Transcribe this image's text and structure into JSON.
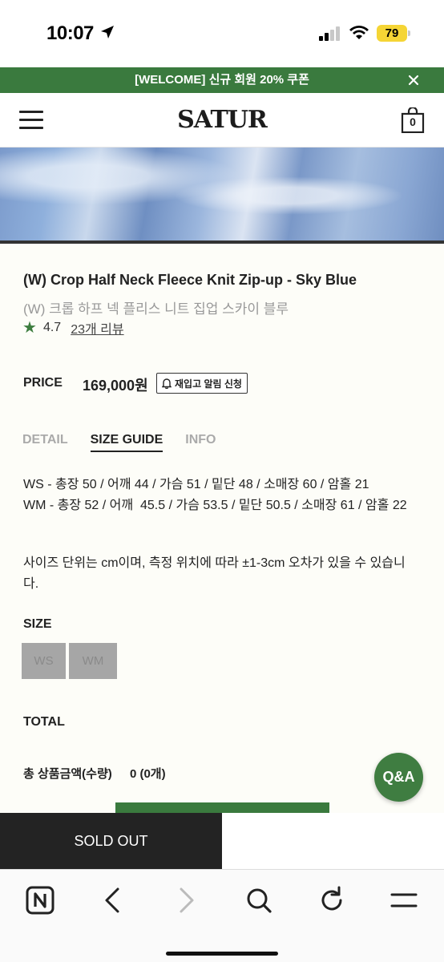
{
  "status_bar": {
    "time": "10:07",
    "battery": "79"
  },
  "promo": {
    "text": "[WELCOME] 신규 회원 20% 쿠폰"
  },
  "header": {
    "logo": "SATUR",
    "cart_count": "0"
  },
  "product": {
    "title_en": "(W) Crop Half Neck Fleece Knit Zip-up - Sky Blue",
    "title_ko": "(W) 크롭 하프 넥 플리스 니트 집업 스카이 블루",
    "rating": "4.7",
    "review_link": "23개 리뷰",
    "price_label": "PRICE",
    "price": "169,000원",
    "restock_button": "재입고 알림 신청"
  },
  "tabs": [
    {
      "label": "DETAIL",
      "active": false
    },
    {
      "label": "SIZE GUIDE",
      "active": true
    },
    {
      "label": "INFO",
      "active": false
    }
  ],
  "size_guide": {
    "line_ws": "WS - 총장 50 / 어깨 44 / 가슴 51 / 밑단 48 / 소매장 60 / 암홀 21",
    "line_wm": "WM - 총장 52 / 어깨  45.5 / 가슴 53.5 / 밑단 50.5 / 소매장 61 / 암홀 22",
    "note": "사이즈 단위는 cm이며, 측정 위치에 따라 ±1-3cm 오차가 있을 수 있습니다."
  },
  "size_section": {
    "label": "SIZE",
    "options": [
      "WS",
      "WM"
    ]
  },
  "total": {
    "label": "TOTAL",
    "row_label": "총 상품금액(수량)",
    "row_value": "0 (0개)"
  },
  "qa_button": "Q&A",
  "actions": {
    "sold_out": "SOLD OUT"
  },
  "colors": {
    "brand_green": "#3a7a3e",
    "sold_out_bg": "#232323",
    "battery": "#f5d535"
  },
  "icons": [
    "location-arrow-icon",
    "signal-icon",
    "wifi-icon",
    "close-icon",
    "menu-icon",
    "cart-icon",
    "star-icon",
    "bell-icon",
    "n-app-icon",
    "back-icon",
    "forward-icon",
    "search-icon",
    "refresh-icon",
    "tabs-menu-icon"
  ]
}
